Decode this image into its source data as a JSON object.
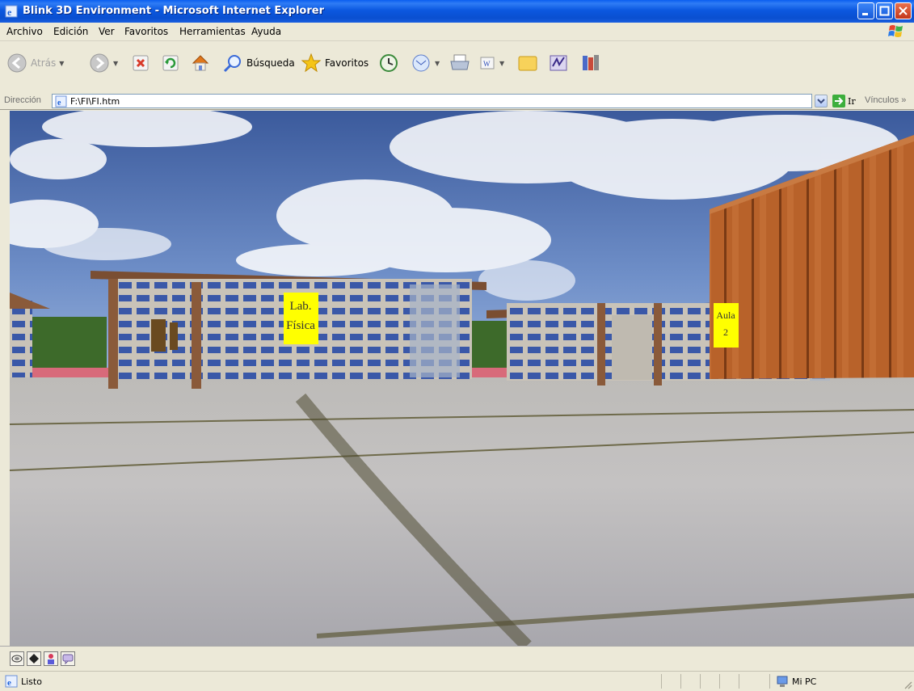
{
  "window": {
    "title": "Blink 3D Environment - Microsoft Internet Explorer",
    "titlebar_color": "#0a58e0"
  },
  "menu": {
    "items": [
      "Archivo",
      "Edición",
      "Ver",
      "Favoritos",
      "Herramientas",
      "Ayuda"
    ]
  },
  "toolbar": {
    "back_label": "Atrás",
    "search_label": "Búsqueda",
    "favorites_label": "Favoritos"
  },
  "address": {
    "label": "Dirección",
    "value": "F:\\FI\\FI.htm",
    "go_label": "Ir",
    "links_label": "Vínculos"
  },
  "scene": {
    "sign_lab_line1": "Lab.",
    "sign_lab_line2": "Física",
    "sign_aula_line1": "Aula",
    "sign_aula_line2": "2",
    "sign_color": "#ffff00"
  },
  "status": {
    "text": "Listo",
    "zone": "Mi PC"
  }
}
